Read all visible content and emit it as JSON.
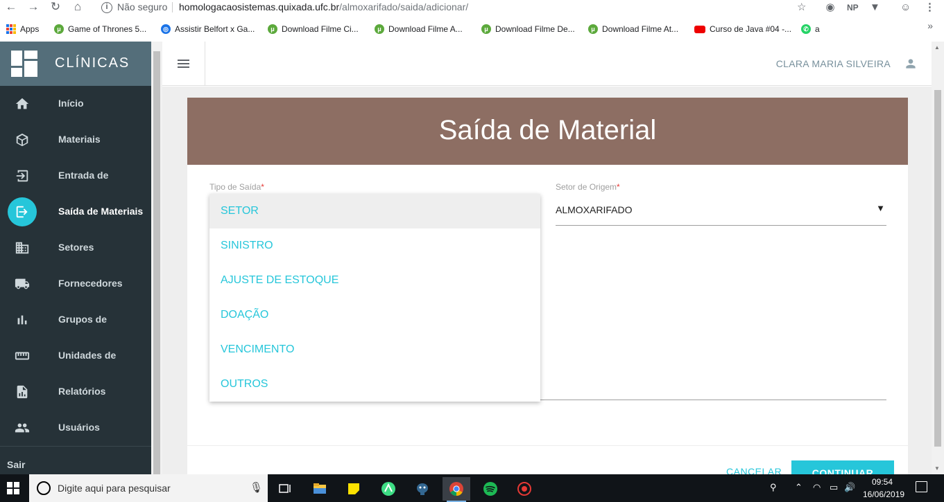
{
  "browser": {
    "insecure_label": "Não seguro",
    "url_host": "homologacaosistemas.quixada.ufc.br",
    "url_path": "/almoxarifado/saida/adicionar/",
    "profile_initials": "NP",
    "bookmarks": [
      {
        "label": "Apps",
        "icon": "apps-grid-icon"
      },
      {
        "label": "Game of Thrones 5...",
        "icon": "torrent-icon"
      },
      {
        "label": "Assistir Belfort x Ga...",
        "icon": "site-icon"
      },
      {
        "label": "Download Filme Ci...",
        "icon": "torrent-icon"
      },
      {
        "label": "Download Filme A...",
        "icon": "torrent-icon"
      },
      {
        "label": "Download Filme De...",
        "icon": "torrent-icon"
      },
      {
        "label": "Download Filme At...",
        "icon": "torrent-icon"
      },
      {
        "label": "Curso de Java #04 -...",
        "icon": "youtube-icon"
      },
      {
        "label": "a",
        "icon": "whatsapp-icon"
      }
    ]
  },
  "sidebar": {
    "brand": "CLÍNICAS",
    "items": [
      {
        "label": "Início",
        "icon": "home-icon"
      },
      {
        "label": "Materiais",
        "icon": "box-icon"
      },
      {
        "label": "Entrada de",
        "icon": "login-icon"
      },
      {
        "label": "Saída de Materiais",
        "icon": "logout-icon",
        "active": true
      },
      {
        "label": "Setores",
        "icon": "building-icon"
      },
      {
        "label": "Fornecedores",
        "icon": "truck-icon"
      },
      {
        "label": "Grupos de",
        "icon": "bar-chart-icon"
      },
      {
        "label": "Unidades de",
        "icon": "ruler-icon"
      },
      {
        "label": "Relatórios",
        "icon": "report-icon"
      },
      {
        "label": "Usuários",
        "icon": "people-icon"
      }
    ],
    "logout": "Sair"
  },
  "header": {
    "user_name": "CLARA MARIA SILVEIRA"
  },
  "form": {
    "title": "Saída de Material",
    "tipo_label": "Tipo de Saída",
    "setor_label": "Setor de Origem",
    "required_mark": "*",
    "setor_value": "ALMOXARIFADO",
    "tipo_options": [
      "SETOR",
      "SINISTRO",
      "AJUSTE DE ESTOQUE",
      "DOAÇÃO",
      "VENCIMENTO",
      "OUTROS"
    ],
    "tipo_selected": "SETOR",
    "cancel_label": "CANCELAR",
    "continue_label": "CONTINUAR"
  },
  "taskbar": {
    "search_placeholder": "Digite aqui para pesquisar",
    "time": "09:54",
    "date": "16/06/2019",
    "apps": [
      "task-view-icon",
      "file-explorer-icon",
      "sticky-notes-icon",
      "android-studio-icon",
      "pgadmin-icon",
      "chrome-icon",
      "spotify-icon",
      "recorder-icon"
    ]
  },
  "colors": {
    "accent": "#26c6da",
    "sidebar_bg": "#263238",
    "brand_bg": "#546e7a",
    "card_header": "#8d6e63"
  }
}
